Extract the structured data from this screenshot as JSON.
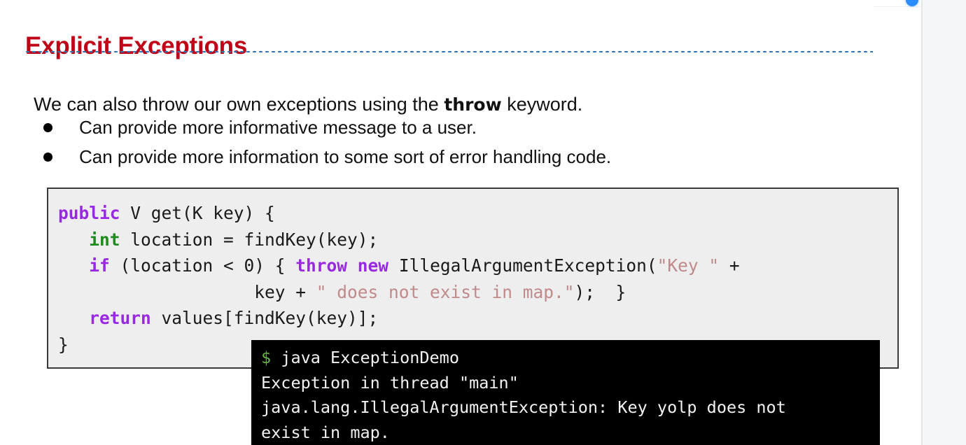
{
  "slide": {
    "title": "Explicit Exceptions",
    "lead": {
      "before": "We can also throw our own exceptions using the ",
      "keyword": "throw",
      "after": " keyword."
    },
    "bullets": [
      "Can provide more informative message to a user.",
      "Can provide more information to some sort of error handling code."
    ]
  },
  "code": {
    "language": "java",
    "lines": [
      [
        {
          "text": "public",
          "style": "keyword"
        },
        {
          "text": " V get(K key) {",
          "style": "plain"
        }
      ],
      [
        {
          "text": "   ",
          "style": "plain"
        },
        {
          "text": "int",
          "style": "type"
        },
        {
          "text": " location = findKey(key);",
          "style": "plain"
        }
      ],
      [
        {
          "text": "   ",
          "style": "plain"
        },
        {
          "text": "if",
          "style": "keyword"
        },
        {
          "text": " (location < 0) { ",
          "style": "plain"
        },
        {
          "text": "throw new",
          "style": "keyword"
        },
        {
          "text": " IllegalArgumentException(",
          "style": "plain"
        },
        {
          "text": "\"Key \"",
          "style": "string"
        },
        {
          "text": " +",
          "style": "plain"
        }
      ],
      [
        {
          "text": "                   key + ",
          "style": "plain"
        },
        {
          "text": "\" does not exist in map.\"",
          "style": "string"
        },
        {
          "text": ");  }",
          "style": "plain"
        }
      ],
      [
        {
          "text": "   ",
          "style": "plain"
        },
        {
          "text": "return",
          "style": "keyword"
        },
        {
          "text": " values[findKey(key)];",
          "style": "plain"
        }
      ],
      [
        {
          "text": "}",
          "style": "plain"
        }
      ]
    ]
  },
  "terminal": {
    "prompt_symbol": "$",
    "command": "java ExceptionDemo",
    "output_lines": [
      "Exception in thread \"main\"",
      "java.lang.IllegalArgumentException: Key yolp does not",
      "exist in map."
    ]
  },
  "colors": {
    "title": "#c00418",
    "rule": "#2e75b6",
    "keyword": "#9929e0",
    "type": "#1e8b1e",
    "string": "#c08a8a",
    "code_bg": "#eeeeee",
    "code_border": "#3a3a3a",
    "terminal_bg": "#000000",
    "terminal_fg": "#f2f2f2",
    "prompt": "#6ab04c",
    "slide_bg": "#ffffff",
    "gutter_bg": "#f5f6f8",
    "accent_dot": "#2b8cff"
  }
}
